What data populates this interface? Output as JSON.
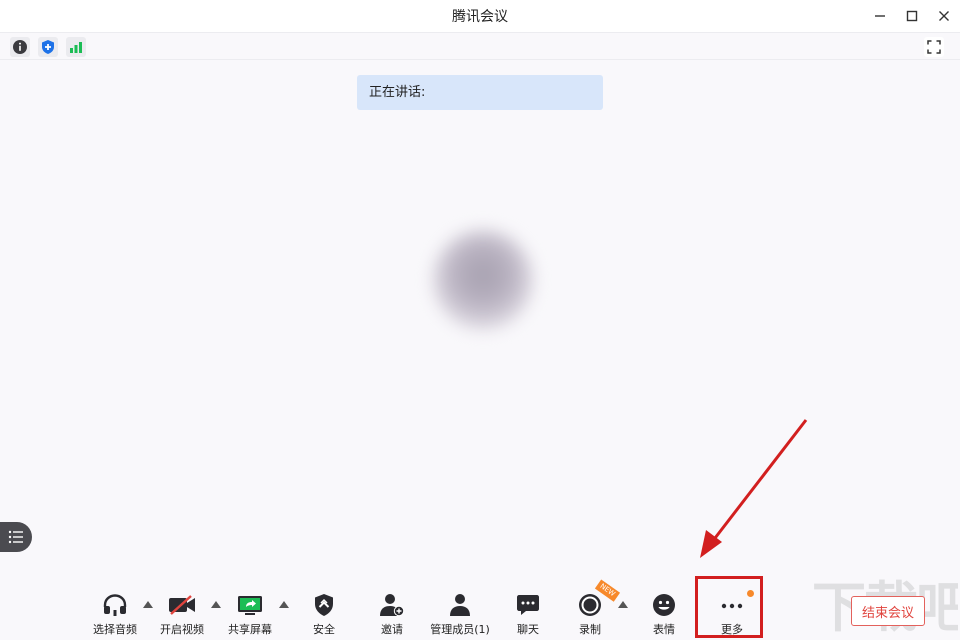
{
  "window": {
    "title": "腾讯会议"
  },
  "speaking": {
    "label": "正在讲话:"
  },
  "toolbar": {
    "audio_label": "选择音频",
    "video_label": "开启视频",
    "share_label": "共享屏幕",
    "security_label": "安全",
    "invite_label": "邀请",
    "members_label": "管理成员(1)",
    "chat_label": "聊天",
    "record_label": "录制",
    "record_badge": "NEW",
    "emoji_label": "表情",
    "more_label": "更多",
    "end_label": "结束会议"
  },
  "watermark": {
    "text": "下载吧"
  },
  "colors": {
    "accent_blue": "#1e72e8",
    "signal_green": "#1bbd55",
    "annotation_red": "#d21f1f",
    "end_red": "#e0443e",
    "badge_orange": "#f7892b"
  }
}
